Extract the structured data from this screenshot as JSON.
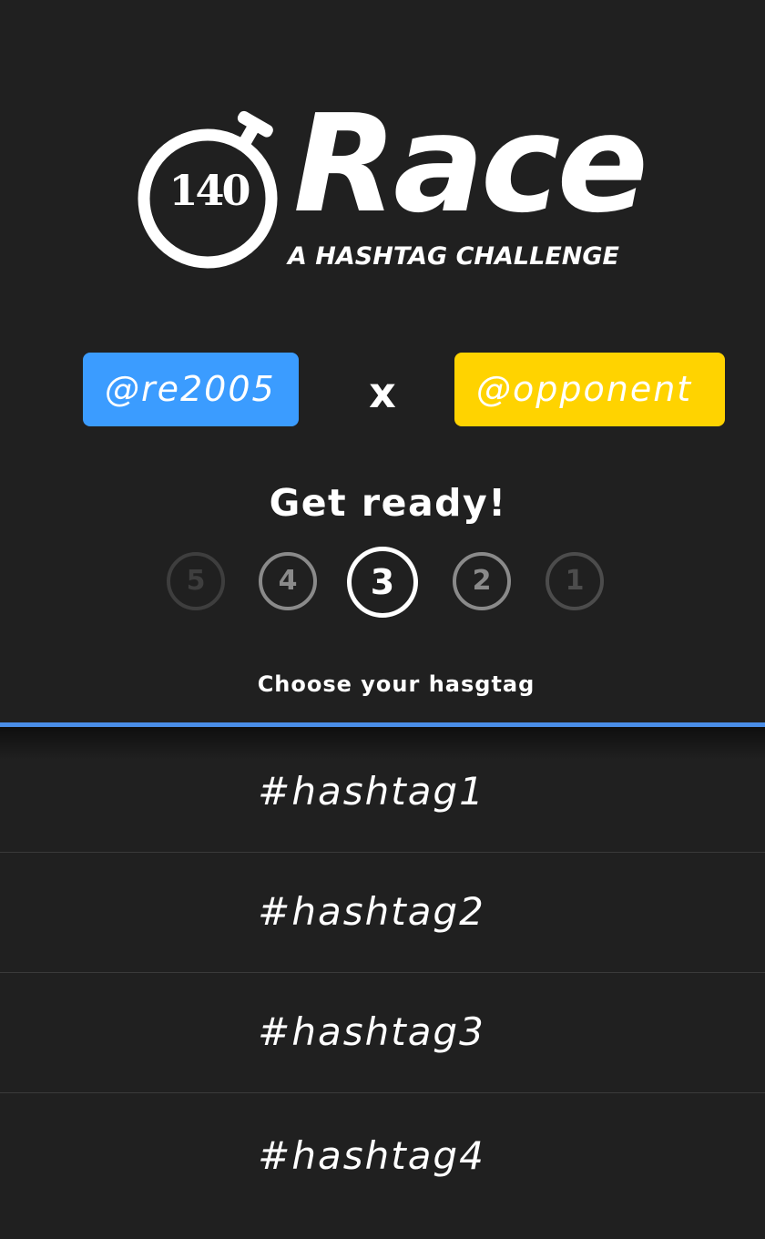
{
  "logo": {
    "number": "140",
    "word": "Race",
    "tagline": "A HASHTAG CHALLENGE",
    "icon": "stopwatch-icon"
  },
  "match": {
    "player": "@re2005",
    "versus": "x",
    "opponent": "@opponent"
  },
  "countdown": {
    "title": "Get ready!",
    "steps": [
      "5",
      "4",
      "3",
      "2",
      "1"
    ],
    "current": "3"
  },
  "choose_label": "Choose your hasgtag",
  "hashtags": [
    "#hashtag1",
    "#hashtag2",
    "#hashtag3",
    "#hashtag4"
  ],
  "colors": {
    "background": "#202020",
    "player": "#3b9cff",
    "opponent": "#ffd300",
    "divider": "#4a8ee8"
  }
}
